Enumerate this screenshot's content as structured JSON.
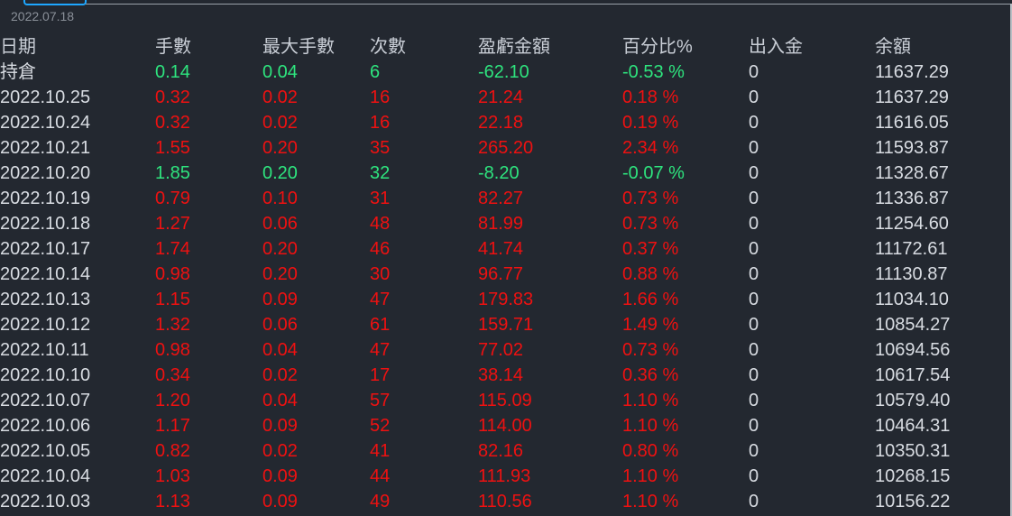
{
  "header": {
    "date_partial": "2022.07.18"
  },
  "colors": {
    "background": "#232830",
    "up": "#ee1111",
    "down": "#2ee47e",
    "text": "#d8dce2",
    "accent": "#1ea7ff"
  },
  "table": {
    "columns": [
      "日期",
      "手數",
      "最大手數",
      "次數",
      "盈虧金額",
      "百分比%",
      "出入金",
      "余額"
    ],
    "rows": [
      {
        "date": "持倉",
        "lots": "0.14",
        "max_lots": "0.04",
        "count": "6",
        "pnl": "-62.10",
        "pct": "-0.53 %",
        "cash": "0",
        "balance": "11637.29",
        "dir": "down"
      },
      {
        "date": "2022.10.25",
        "lots": "0.32",
        "max_lots": "0.02",
        "count": "16",
        "pnl": "21.24",
        "pct": "0.18 %",
        "cash": "0",
        "balance": "11637.29",
        "dir": "up"
      },
      {
        "date": "2022.10.24",
        "lots": "0.32",
        "max_lots": "0.02",
        "count": "16",
        "pnl": "22.18",
        "pct": "0.19 %",
        "cash": "0",
        "balance": "11616.05",
        "dir": "up"
      },
      {
        "date": "2022.10.21",
        "lots": "1.55",
        "max_lots": "0.20",
        "count": "35",
        "pnl": "265.20",
        "pct": "2.34 %",
        "cash": "0",
        "balance": "11593.87",
        "dir": "up"
      },
      {
        "date": "2022.10.20",
        "lots": "1.85",
        "max_lots": "0.20",
        "count": "32",
        "pnl": "-8.20",
        "pct": "-0.07 %",
        "cash": "0",
        "balance": "11328.67",
        "dir": "down"
      },
      {
        "date": "2022.10.19",
        "lots": "0.79",
        "max_lots": "0.10",
        "count": "31",
        "pnl": "82.27",
        "pct": "0.73 %",
        "cash": "0",
        "balance": "11336.87",
        "dir": "up"
      },
      {
        "date": "2022.10.18",
        "lots": "1.27",
        "max_lots": "0.06",
        "count": "48",
        "pnl": "81.99",
        "pct": "0.73 %",
        "cash": "0",
        "balance": "11254.60",
        "dir": "up"
      },
      {
        "date": "2022.10.17",
        "lots": "1.74",
        "max_lots": "0.20",
        "count": "46",
        "pnl": "41.74",
        "pct": "0.37 %",
        "cash": "0",
        "balance": "11172.61",
        "dir": "up"
      },
      {
        "date": "2022.10.14",
        "lots": "0.98",
        "max_lots": "0.20",
        "count": "30",
        "pnl": "96.77",
        "pct": "0.88 %",
        "cash": "0",
        "balance": "11130.87",
        "dir": "up"
      },
      {
        "date": "2022.10.13",
        "lots": "1.15",
        "max_lots": "0.09",
        "count": "47",
        "pnl": "179.83",
        "pct": "1.66 %",
        "cash": "0",
        "balance": "11034.10",
        "dir": "up"
      },
      {
        "date": "2022.10.12",
        "lots": "1.32",
        "max_lots": "0.06",
        "count": "61",
        "pnl": "159.71",
        "pct": "1.49 %",
        "cash": "0",
        "balance": "10854.27",
        "dir": "up"
      },
      {
        "date": "2022.10.11",
        "lots": "0.98",
        "max_lots": "0.04",
        "count": "47",
        "pnl": "77.02",
        "pct": "0.73 %",
        "cash": "0",
        "balance": "10694.56",
        "dir": "up"
      },
      {
        "date": "2022.10.10",
        "lots": "0.34",
        "max_lots": "0.02",
        "count": "17",
        "pnl": "38.14",
        "pct": "0.36 %",
        "cash": "0",
        "balance": "10617.54",
        "dir": "up"
      },
      {
        "date": "2022.10.07",
        "lots": "1.20",
        "max_lots": "0.04",
        "count": "57",
        "pnl": "115.09",
        "pct": "1.10 %",
        "cash": "0",
        "balance": "10579.40",
        "dir": "up"
      },
      {
        "date": "2022.10.06",
        "lots": "1.17",
        "max_lots": "0.09",
        "count": "52",
        "pnl": "114.00",
        "pct": "1.10 %",
        "cash": "0",
        "balance": "10464.31",
        "dir": "up"
      },
      {
        "date": "2022.10.05",
        "lots": "0.82",
        "max_lots": "0.02",
        "count": "41",
        "pnl": "82.16",
        "pct": "0.80 %",
        "cash": "0",
        "balance": "10350.31",
        "dir": "up"
      },
      {
        "date": "2022.10.04",
        "lots": "1.03",
        "max_lots": "0.09",
        "count": "44",
        "pnl": "111.93",
        "pct": "1.10 %",
        "cash": "0",
        "balance": "10268.15",
        "dir": "up"
      },
      {
        "date": "2022.10.03",
        "lots": "1.13",
        "max_lots": "0.09",
        "count": "49",
        "pnl": "110.56",
        "pct": "1.10 %",
        "cash": "0",
        "balance": "10156.22",
        "dir": "up"
      }
    ]
  }
}
